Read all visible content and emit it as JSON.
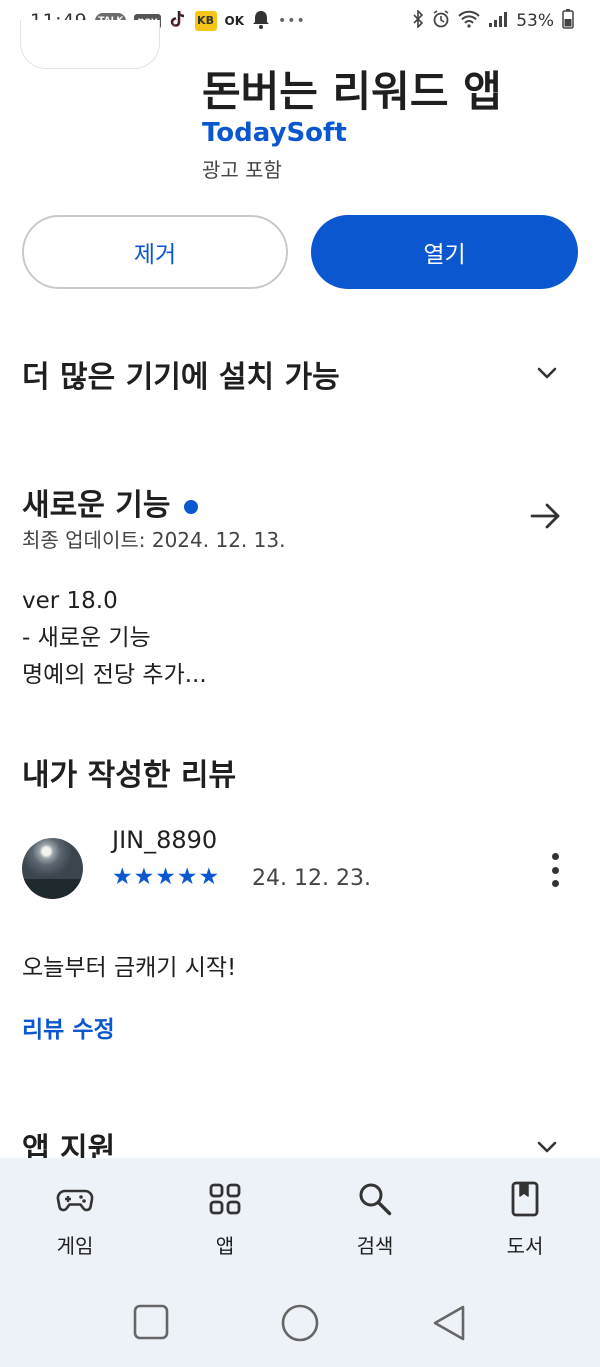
{
  "status_bar": {
    "time": "11:49",
    "talk_badge": "TALK",
    "pay_badge": "pay",
    "ok_badge": "OK",
    "kb_badge": "KB",
    "more": "•••",
    "battery": "53%"
  },
  "app": {
    "title": "돈버는 리워드 앱",
    "developer": "TodaySoft",
    "ad_label": "광고 포함"
  },
  "actions": {
    "remove_label": "제거",
    "open_label": "열기"
  },
  "sections": {
    "more_devices": "더 많은 기기에 설치 가능",
    "whats_new": {
      "title": "새로운 기능",
      "updated": "최종 업데이트: 2024. 12. 13.",
      "lines": [
        "ver 18.0",
        "- 새로운 기능",
        "명예의 전당 추가..."
      ]
    },
    "my_review": {
      "title": "내가 작성한 리뷰",
      "reviewer": "JIN_8890",
      "stars": "★★★★★",
      "rating": 5,
      "date": "24. 12. 23.",
      "text": "오늘부터 금캐기 시작!",
      "edit_label": "리뷰 수정"
    },
    "app_support": "앱 지원"
  },
  "bottom_nav": [
    {
      "label": "게임",
      "icon": "gamepad-icon"
    },
    {
      "label": "앱",
      "icon": "apps-grid-icon"
    },
    {
      "label": "검색",
      "icon": "search-icon"
    },
    {
      "label": "도서",
      "icon": "book-icon"
    }
  ],
  "colors": {
    "accent": "#0b57d0",
    "nav_bg": "#edf1f8"
  }
}
